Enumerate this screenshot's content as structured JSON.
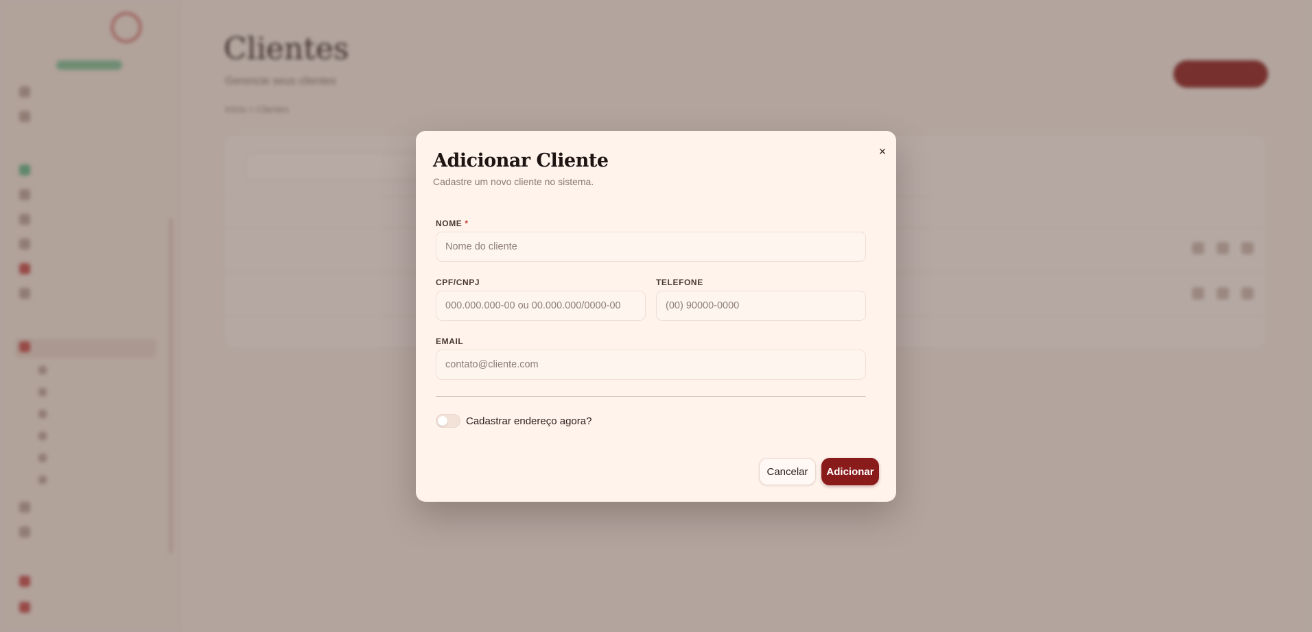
{
  "background": {
    "page_title": "Clientes",
    "page_subtitle": "Gerencie seus clientes",
    "breadcrumb": "Início  >  Clientes"
  },
  "modal": {
    "title": "Adicionar Cliente",
    "description": "Cadastre um novo cliente no sistema.",
    "close_icon": "×",
    "fields": {
      "nome": {
        "label": "NOME",
        "required_mark": "*",
        "placeholder": "Nome do cliente",
        "value": ""
      },
      "cpf_cnpj": {
        "label": "CPF/CNPJ",
        "placeholder": "000.000.000-00 ou 00.000.000/0000-00",
        "value": ""
      },
      "telefone": {
        "label": "TELEFONE",
        "placeholder": "(00) 90000-0000",
        "value": ""
      },
      "email": {
        "label": "EMAIL",
        "placeholder": "contato@cliente.com",
        "value": ""
      }
    },
    "address_toggle": {
      "label": "Cadastrar endereço agora?",
      "checked": false
    },
    "buttons": {
      "cancel": "Cancelar",
      "submit": "Adicionar"
    }
  },
  "colors": {
    "accent": "#8a1b1b",
    "modal_bg": "#fff3ec",
    "required": "#c0392b"
  }
}
